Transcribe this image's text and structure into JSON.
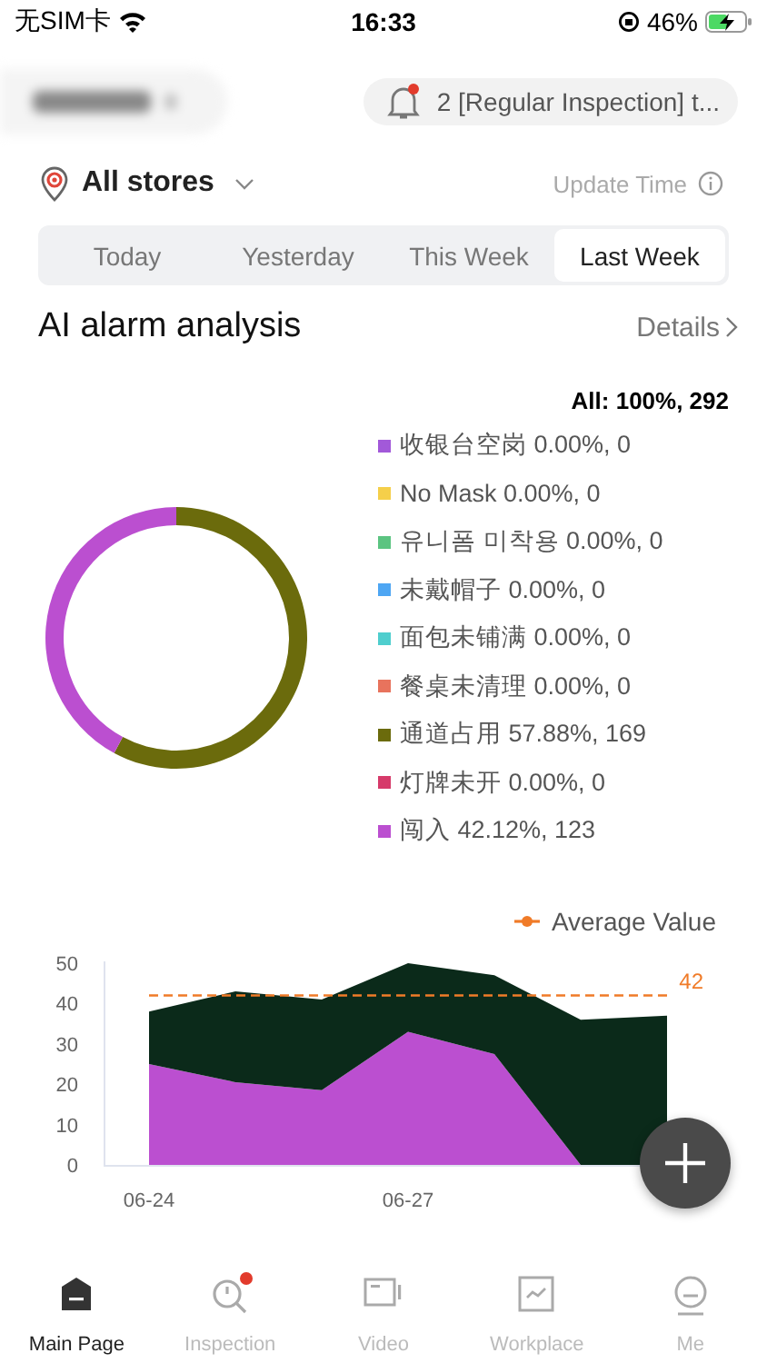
{
  "status_bar": {
    "carrier": "无SIM卡",
    "time": "16:33",
    "battery": "46%"
  },
  "notification": {
    "text": "2 [Regular Inspection] t...",
    "unread": true
  },
  "store_selector": {
    "label": "All stores",
    "update_time": "Update Time"
  },
  "tabs": [
    {
      "label": "Today",
      "selected": false
    },
    {
      "label": "Yesterday",
      "selected": false
    },
    {
      "label": "This Week",
      "selected": false
    },
    {
      "label": "Last Week",
      "selected": true
    }
  ],
  "alarm_analysis": {
    "title": "AI alarm analysis",
    "details": "Details",
    "total": "All: 100%, 292",
    "chart_data": {
      "type": "donut",
      "categories": [
        "收银台空岗",
        "No Mask",
        "유니폼 미착용",
        "未戴帽子",
        "面包未铺满",
        "餐桌未清理",
        "通道占用",
        "灯牌未开",
        "闯入"
      ],
      "series": [
        {
          "values": [
            0,
            0,
            0,
            0,
            0,
            0,
            57.88,
            0,
            42.12
          ]
        }
      ],
      "colors": [
        "#a259d9",
        "#f5cf4a",
        "#5cc481",
        "#4ea6f3",
        "#4fcece",
        "#e8735d",
        "#6b6b0c",
        "#d63a6a",
        "#bb4fd0"
      ],
      "value_labels": [
        "0.00%, 0",
        "0.00%, 0",
        "0.00%, 0",
        "0.00%, 0",
        "0.00%, 0",
        "0.00%, 0",
        "57.88%, 169",
        "0.00%, 0",
        "42.12%, 123"
      ]
    }
  },
  "trend": {
    "chart_data": {
      "type": "area",
      "stacked": true,
      "categories": [
        "06-24",
        null,
        null,
        "06-27",
        null,
        null,
        null
      ],
      "yticks": [
        0,
        10,
        20,
        30,
        40,
        50
      ],
      "ylim": [
        0,
        50
      ],
      "series": [
        {
          "color": "#bb4fd0",
          "values": [
            25,
            20.5,
            18.5,
            33,
            27.5,
            0,
            null
          ]
        },
        {
          "color": "#0b2a1a",
          "values": [
            13,
            22.5,
            22.5,
            17,
            19.5,
            36,
            37
          ]
        },
        {
          "name": "Average Value",
          "type": "line",
          "line_style": "dashed",
          "color": "#f07b28",
          "values": [
            42,
            42,
            42,
            42,
            42,
            42,
            42
          ]
        }
      ],
      "annotations": [
        "42"
      ]
    }
  },
  "nav": [
    {
      "label": "Main Page",
      "selected": true,
      "badge": false
    },
    {
      "label": "Inspection",
      "selected": false,
      "badge": true
    },
    {
      "label": "Video",
      "selected": false,
      "badge": false
    },
    {
      "label": "Workplace",
      "selected": false,
      "badge": false
    },
    {
      "label": "Me",
      "selected": false,
      "badge": false
    }
  ]
}
